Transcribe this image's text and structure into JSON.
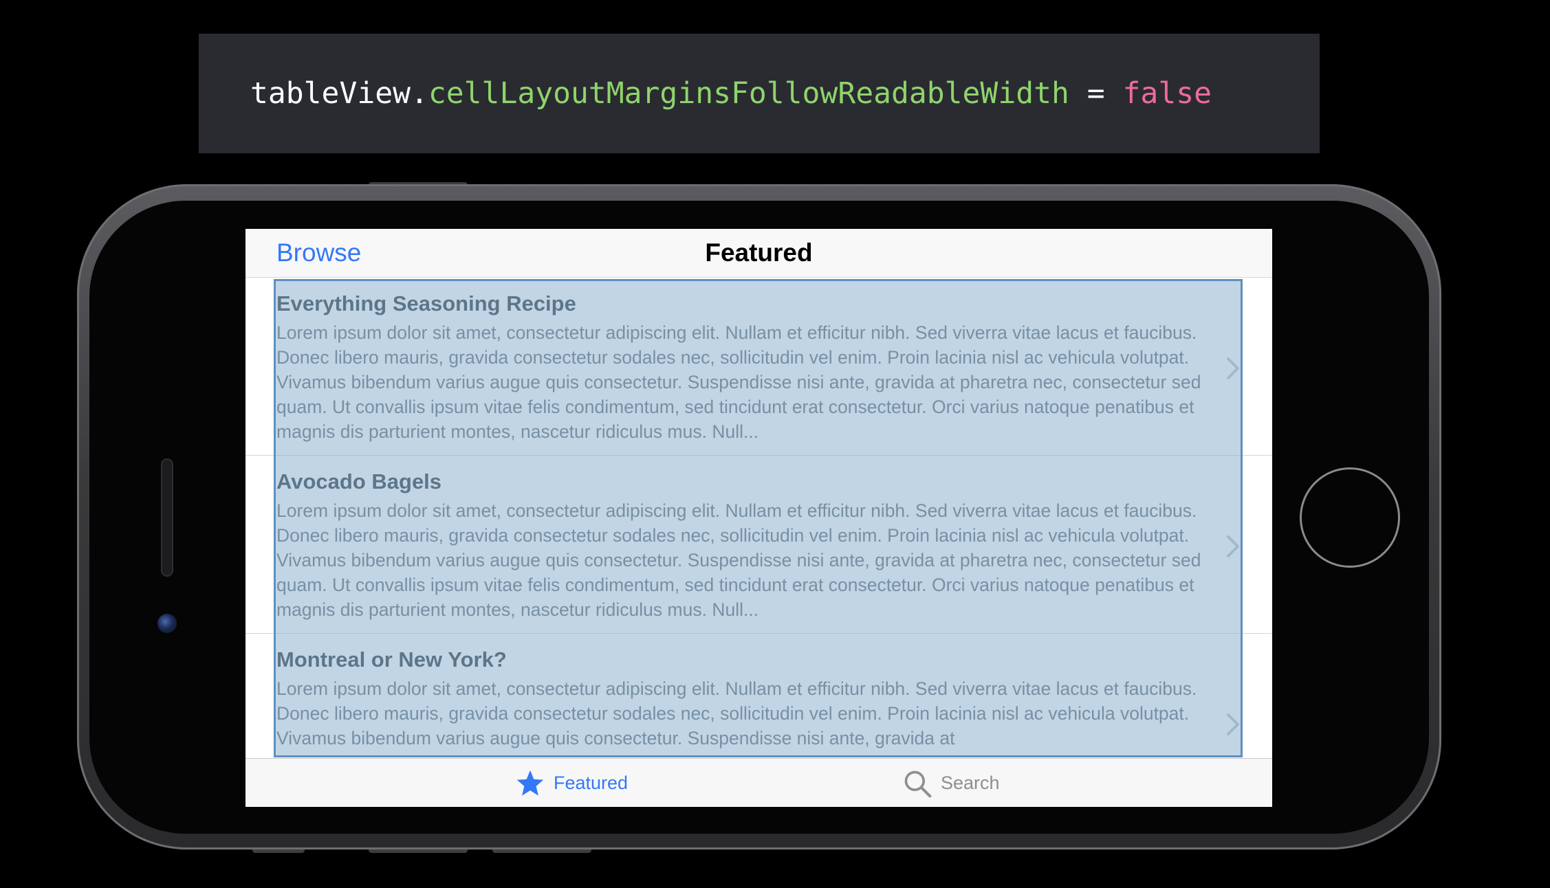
{
  "code": {
    "object": "tableView",
    "dot": ".",
    "property": "cellLayoutMarginsFollowReadableWidth",
    "operator": " = ",
    "value": "false"
  },
  "nav": {
    "back_label": "Browse",
    "title": "Featured"
  },
  "cells": [
    {
      "title": "Everything Seasoning Recipe",
      "body": "Lorem ipsum dolor sit amet, consectetur adipiscing elit. Nullam et efficitur nibh. Sed viverra vitae lacus et faucibus. Donec libero mauris, gravida consectetur sodales nec, sollicitudin vel enim. Proin lacinia nisl ac vehicula volutpat. Vivamus bibendum varius augue quis consectetur. Suspendisse nisi ante, gravida at pharetra nec, consectetur sed quam. Ut convallis ipsum vitae felis condimentum, sed tincidunt erat consectetur. Orci varius natoque penatibus et magnis dis parturient montes, nascetur ridiculus mus. Null..."
    },
    {
      "title": "Avocado Bagels",
      "body": "Lorem ipsum dolor sit amet, consectetur adipiscing elit. Nullam et efficitur nibh. Sed viverra vitae lacus et faucibus. Donec libero mauris, gravida consectetur sodales nec, sollicitudin vel enim. Proin lacinia nisl ac vehicula volutpat. Vivamus bibendum varius augue quis consectetur. Suspendisse nisi ante, gravida at pharetra nec, consectetur sed quam. Ut convallis ipsum vitae felis condimentum, sed tincidunt erat consectetur. Orci varius natoque penatibus et magnis dis parturient montes, nascetur ridiculus mus. Null..."
    },
    {
      "title": "Montreal or New York?",
      "body": "Lorem ipsum dolor sit amet, consectetur adipiscing elit. Nullam et efficitur nibh. Sed viverra vitae lacus et faucibus. Donec libero mauris, gravida consectetur sodales nec, sollicitudin vel enim. Proin lacinia nisl ac vehicula volutpat. Vivamus bibendum varius augue quis consectetur. Suspendisse nisi ante, gravida at"
    }
  ],
  "tabs": [
    {
      "label": "Featured",
      "icon": "star-icon",
      "selected": true
    },
    {
      "label": "Search",
      "icon": "search-icon",
      "selected": false
    }
  ],
  "colors": {
    "tint": "#3478f6",
    "highlight": "#8eb2d0",
    "code_property": "#8fd46c",
    "code_keyword": "#ee6b9c"
  }
}
